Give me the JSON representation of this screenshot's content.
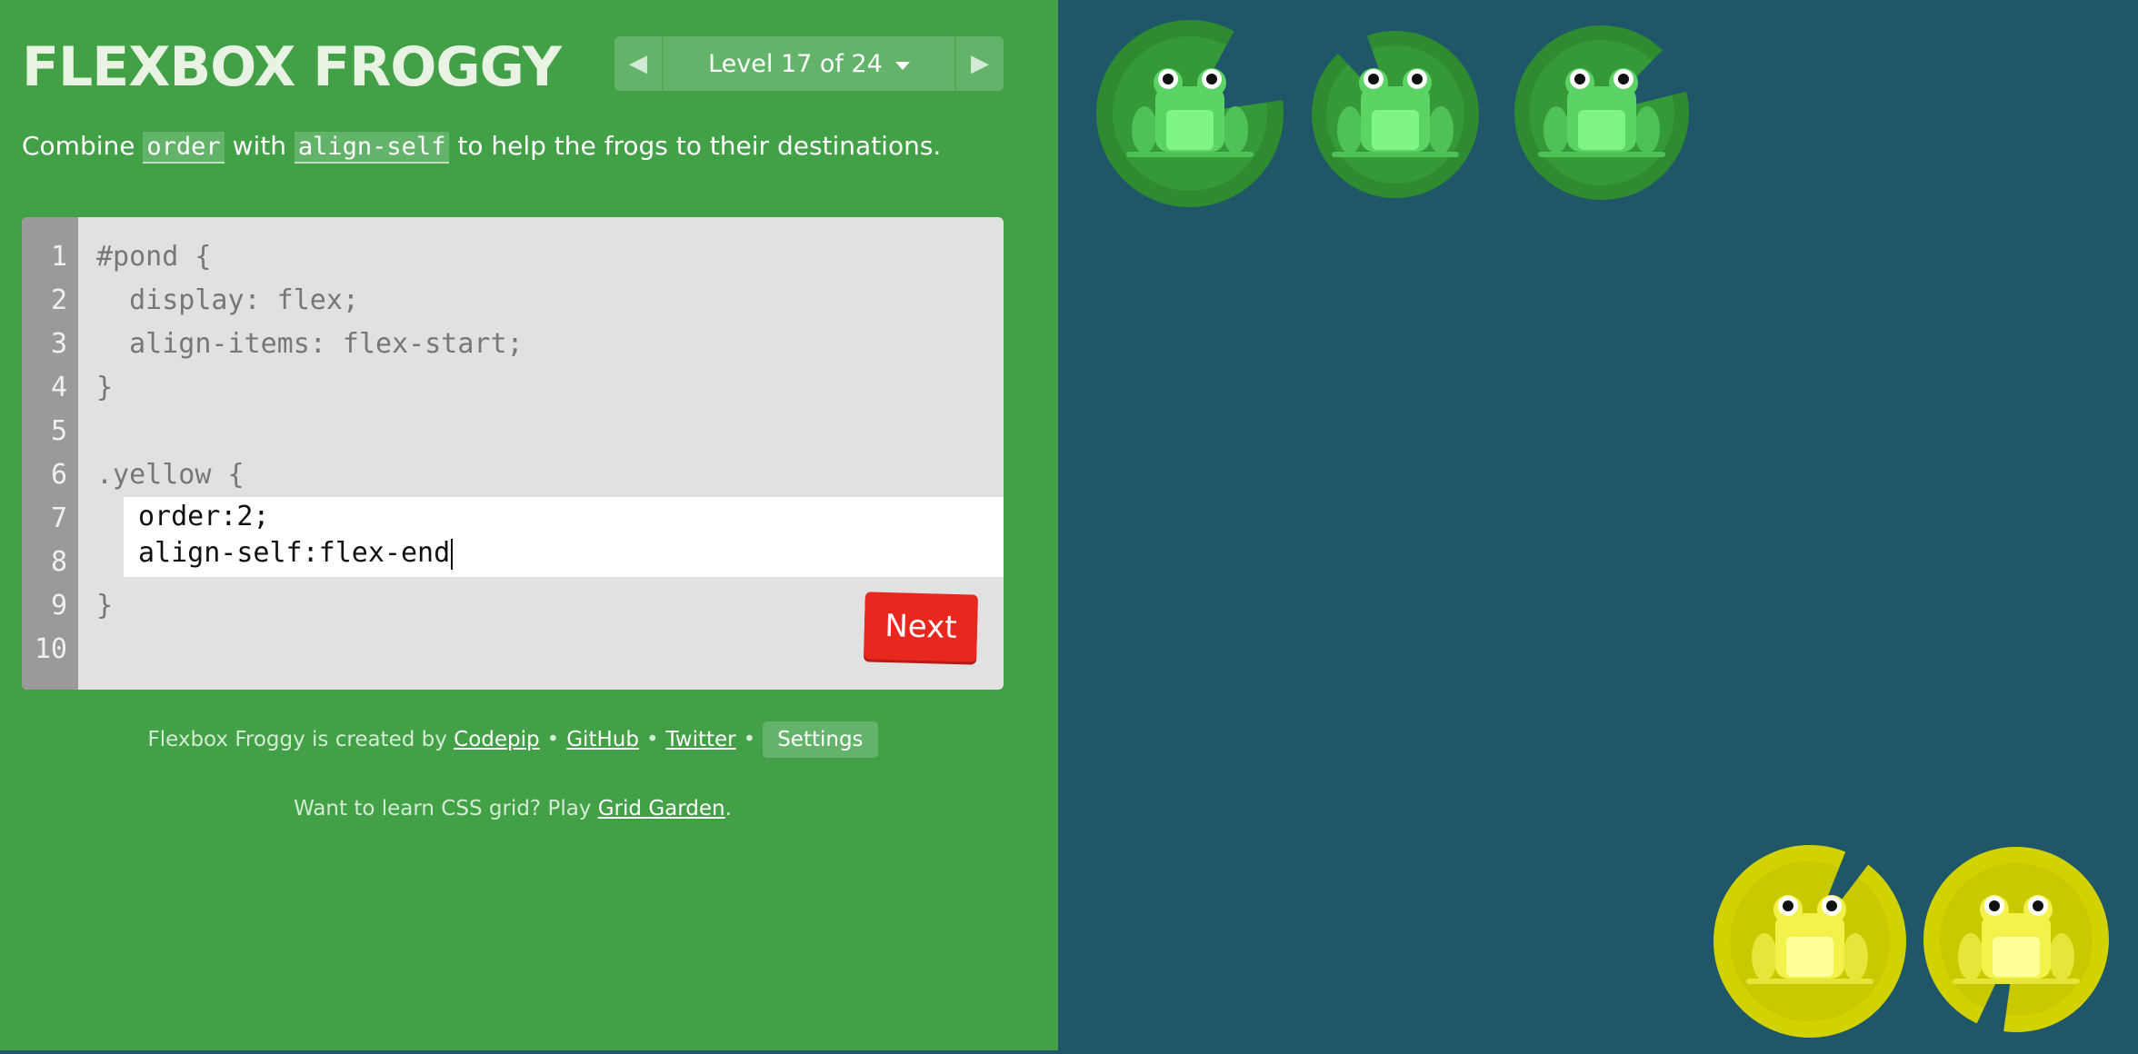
{
  "app": {
    "title": "FLEXBOX FROGGY"
  },
  "level_nav": {
    "label": "Level 17 of 24",
    "prev_icon": "triangle-left-icon",
    "next_icon": "triangle-right-icon",
    "dropdown_icon": "caret-down-icon"
  },
  "instructions": {
    "part1": "Combine ",
    "code1": "order",
    "part2": " with ",
    "code2": "align-self",
    "part3": " to help the frogs to their destinations."
  },
  "editor": {
    "line_numbers": [
      "1",
      "2",
      "3",
      "4",
      "5",
      "6",
      "7",
      "8",
      "9",
      "10"
    ],
    "lines": {
      "l1": "#pond {",
      "l2": "  display: flex;",
      "l3": "  align-items: flex-start;",
      "l4": "}",
      "l6": ".yellow {",
      "l9": "}"
    },
    "answer": {
      "line1": "order:2;",
      "line2": "align-self:flex-end"
    },
    "next_label": "Next"
  },
  "footer": {
    "credit_prefix": "Flexbox Froggy is created by ",
    "codepip": "Codepip",
    "sep": "•",
    "github": "GitHub",
    "twitter": "Twitter",
    "settings": "Settings",
    "grid_prefix": "Want to learn CSS grid? Play ",
    "grid_link": "Grid Garden",
    "grid_suffix": "."
  },
  "pond": {
    "frogs": [
      {
        "color": "green"
      },
      {
        "color": "green"
      },
      {
        "color": "green"
      },
      {
        "color": "yellow"
      },
      {
        "color": "yellow"
      }
    ]
  },
  "colors": {
    "sidebar": "#42a047",
    "pond": "#1f5768",
    "next_button": "#e8271f",
    "green_lily": "#2a8a2e",
    "green_frog": "#5cd465",
    "yellow_lily": "#c4c400",
    "yellow_frog": "#f0f040"
  }
}
